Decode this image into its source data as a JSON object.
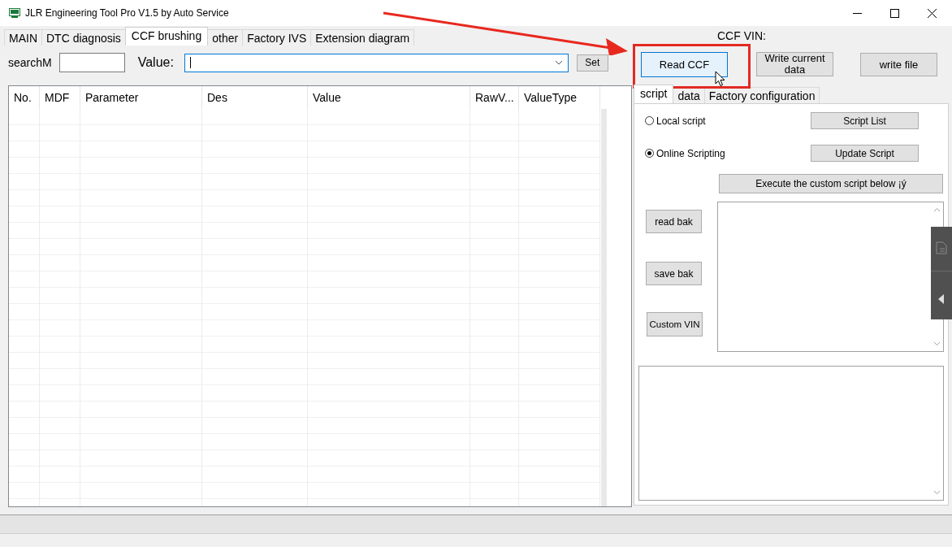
{
  "window": {
    "title": "JLR Engineering Tool Pro V1.5 by Auto Service"
  },
  "tabs": [
    {
      "label": "MAIN",
      "selected": false
    },
    {
      "label": "DTC diagnosis",
      "selected": false
    },
    {
      "label": "CCF brushing",
      "selected": true
    },
    {
      "label": "other",
      "selected": false
    },
    {
      "label": "Factory IVS",
      "selected": false
    },
    {
      "label": "Extension diagram",
      "selected": false
    }
  ],
  "search": {
    "label": "searchM",
    "value_label": "Value:",
    "set_button": "Set"
  },
  "table": {
    "columns": [
      "No.",
      "MDF",
      "Parameter",
      "Des",
      "Value",
      "RawV...",
      "ValueType"
    ]
  },
  "ccf_vin_label": "CCF VIN:",
  "actions": [
    {
      "label": "Read CCF",
      "hovered": true
    },
    {
      "label": "Write current data",
      "hovered": false
    },
    {
      "label": "write file",
      "hovered": false
    }
  ],
  "subtabs": [
    {
      "label": "script",
      "selected": true
    },
    {
      "label": "data",
      "selected": false
    },
    {
      "label": "Factory configuration",
      "selected": false
    }
  ],
  "script_source": [
    {
      "label": "Local script",
      "selected": false
    },
    {
      "label": "Online Scripting",
      "selected": true
    }
  ],
  "script_buttons": [
    "Script List",
    "Update Script"
  ],
  "execute_button": "Execute the custom script below ¡ý",
  "backup_buttons": [
    "read bak",
    "save bak",
    "Custom VIN"
  ]
}
